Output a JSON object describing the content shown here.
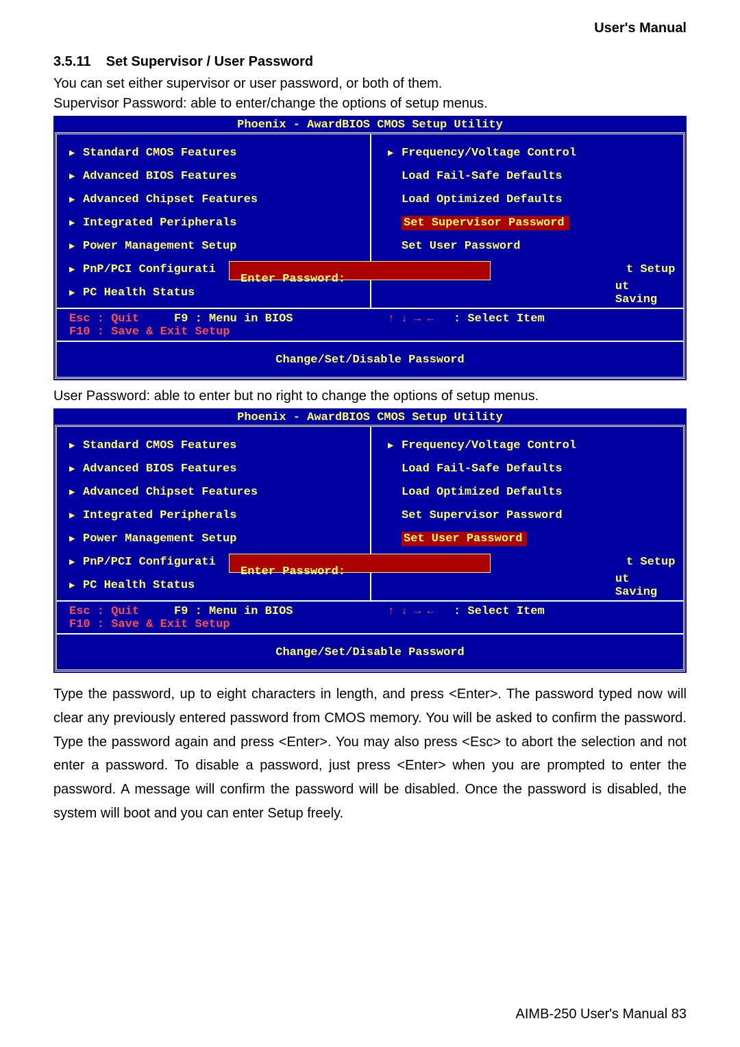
{
  "header": "User's  Manual",
  "section_num": "3.5.11",
  "section_title": "Set Supervisor / User Password",
  "intro1": "You can set either supervisor or user password, or both of them.",
  "intro2": "Supervisor Password: able to enter/change the options of setup menus.",
  "mid_para": "User Password: able to enter but no right to change the options of setup menus.",
  "bios1": {
    "title": "Phoenix - AwardBIOS CMOS Setup Utility",
    "left": [
      "Standard CMOS Features",
      "Advanced BIOS Features",
      "Advanced Chipset Features",
      "Integrated Peripherals",
      "Power Management Setup",
      "PnP/PCI Configurati",
      "PC Health Status"
    ],
    "right_items": {
      "freq": "Frequency/Voltage Control",
      "fail": "Load Fail-Safe Defaults",
      "opt": "Load Optimized Defaults",
      "sup": "Set Supervisor Password",
      "user": "Set User Password",
      "exit_setup": "t Setup",
      "exit_saving": "ut Saving"
    },
    "prompt": "Enter Password:",
    "bottom": {
      "esc": "Esc : Quit",
      "f9": "F9 : Menu in BIOS",
      "select": ": Select Item",
      "arrows": "↑ ↓ → ←",
      "f10": "F10 : Save & Exit Setup"
    },
    "footer": "Change/Set/Disable Password"
  },
  "bios2": {
    "title": "Phoenix - AwardBIOS CMOS Setup Utility",
    "left": [
      "Standard CMOS Features",
      "Advanced BIOS Features",
      "Advanced Chipset Features",
      "Integrated Peripherals",
      "Power Management Setup",
      "PnP/PCI Configurati",
      "PC Health Status"
    ],
    "right_items": {
      "freq": "Frequency/Voltage Control",
      "fail": "Load Fail-Safe Defaults",
      "opt": "Load Optimized Defaults",
      "sup": "Set Supervisor Password",
      "user": "Set User Password",
      "exit_setup": "t Setup",
      "exit_saving": "ut Saving"
    },
    "prompt": "Enter Password:",
    "bottom": {
      "esc": "Esc : Quit",
      "f9": "F9 : Menu in BIOS",
      "select": ": Select Item",
      "arrows": "↑ ↓ → ←",
      "f10": "F10 : Save & Exit Setup"
    },
    "footer": "Change/Set/Disable Password"
  },
  "body_para": "Type the password, up to eight characters in length, and press <Enter>. The password typed now will clear any previously entered password from CMOS memory. You will be asked to confirm the password. Type the password again and press <Enter>. You may also press <Esc> to abort the selection and not enter a password. To disable a password, just press <Enter> when you are prompted to enter the password. A message will confirm the password will be disabled. Once the password is disabled, the system will boot and you can enter Setup freely.",
  "page_footer": "AIMB-250  User's  Manual 83"
}
